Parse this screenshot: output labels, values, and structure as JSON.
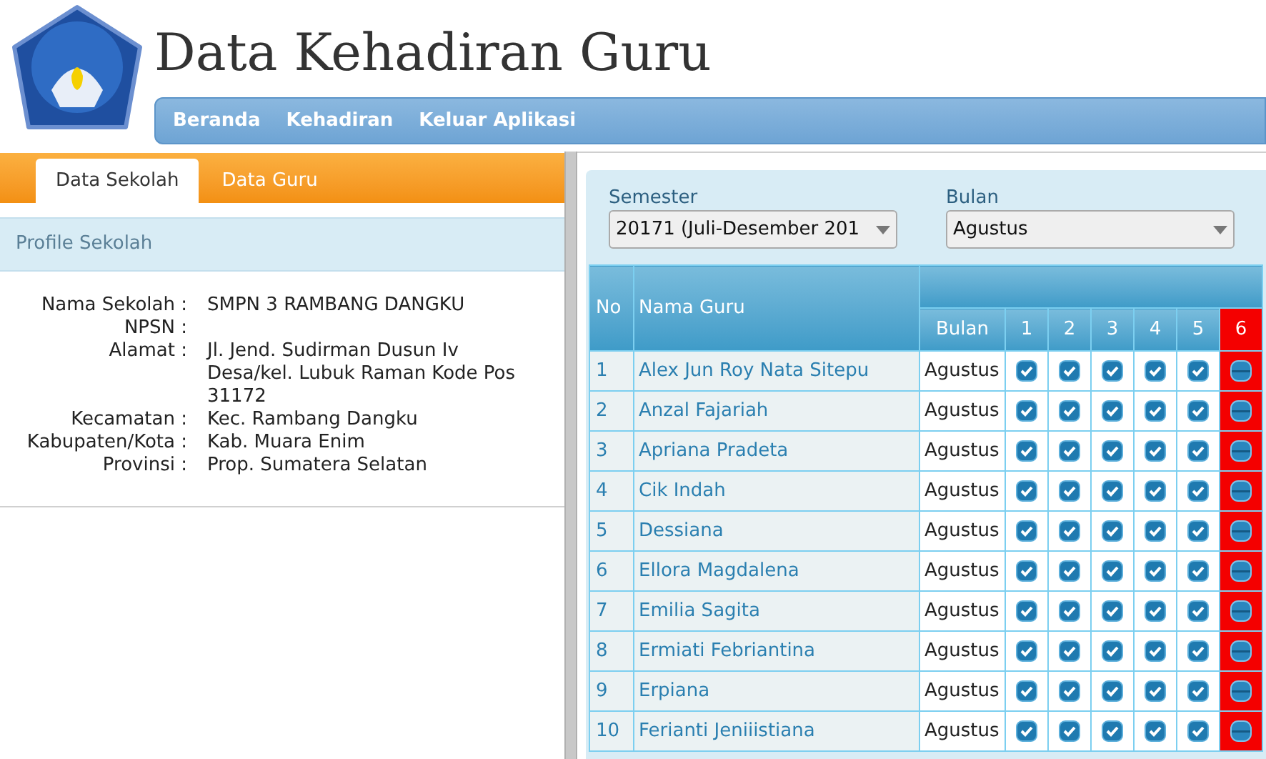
{
  "title": "Data Kehadiran Guru",
  "nav": [
    {
      "label": "Beranda"
    },
    {
      "label": "Kehadiran"
    },
    {
      "label": "Keluar Aplikasi"
    }
  ],
  "tabs": [
    {
      "label": "Data Sekolah",
      "selected": true
    },
    {
      "label": "Data Guru",
      "selected": false
    }
  ],
  "profile": {
    "heading": "Profile Sekolah",
    "fields": [
      {
        "label": "Nama Sekolah :",
        "value": "SMPN 3 RAMBANG DANGKU"
      },
      {
        "label": "NPSN :"
      },
      {
        "label": "Alamat :",
        "value": "Jl. Jend. Sudirman Dusun Iv Desa/kel. Lubuk Raman Kode Pos 31172"
      },
      {
        "label": "Kecamatan :",
        "value": "Kec. Rambang Dangku"
      },
      {
        "label": "Kabupaten/Kota :",
        "value": "Kab. Muara Enim"
      },
      {
        "label": "Provinsi :",
        "value": "Prop. Sumatera Selatan"
      }
    ]
  },
  "filters": [
    {
      "label": "Semester",
      "value": "20171 (Juli-Desember 201"
    },
    {
      "label": "Bulan",
      "value": "Agustus"
    }
  ],
  "table": {
    "columns": [
      "No",
      "Nama Guru",
      "Bulan"
    ],
    "days": [
      {
        "label": "1",
        "holiday": false
      },
      {
        "label": "2",
        "holiday": false
      },
      {
        "label": "3",
        "holiday": false
      },
      {
        "label": "4",
        "holiday": false
      },
      {
        "label": "5",
        "holiday": false
      },
      {
        "label": "6",
        "holiday": true
      }
    ],
    "rows": [
      {
        "no": "1",
        "name": "Alex Jun Roy Nata Sitepu",
        "month": "Agustus",
        "days": [
          true,
          true,
          true,
          true,
          true,
          false
        ]
      },
      {
        "no": "2",
        "name": "Anzal Fajariah",
        "month": "Agustus",
        "days": [
          true,
          true,
          true,
          true,
          true,
          false
        ]
      },
      {
        "no": "3",
        "name": "Apriana Pradeta",
        "month": "Agustus",
        "days": [
          true,
          true,
          true,
          true,
          true,
          false
        ]
      },
      {
        "no": "4",
        "name": "Cik Indah",
        "month": "Agustus",
        "days": [
          true,
          true,
          true,
          true,
          true,
          false
        ]
      },
      {
        "no": "5",
        "name": "Dessiana",
        "month": "Agustus",
        "days": [
          true,
          true,
          true,
          true,
          true,
          false
        ]
      },
      {
        "no": "6",
        "name": "Ellora Magdalena",
        "month": "Agustus",
        "days": [
          true,
          true,
          true,
          true,
          true,
          false
        ]
      },
      {
        "no": "7",
        "name": "Emilia Sagita",
        "month": "Agustus",
        "days": [
          true,
          true,
          true,
          true,
          true,
          false
        ]
      },
      {
        "no": "8",
        "name": "Ermiati Febriantina",
        "month": "Agustus",
        "days": [
          true,
          true,
          true,
          true,
          true,
          false
        ]
      },
      {
        "no": "9",
        "name": "Erpiana",
        "month": "Agustus",
        "days": [
          true,
          true,
          true,
          true,
          true,
          false
        ]
      },
      {
        "no": "10",
        "name": "Ferianti Jeniiistiana",
        "month": "Agustus",
        "days": [
          true,
          true,
          true,
          true,
          true,
          false
        ]
      }
    ]
  }
}
